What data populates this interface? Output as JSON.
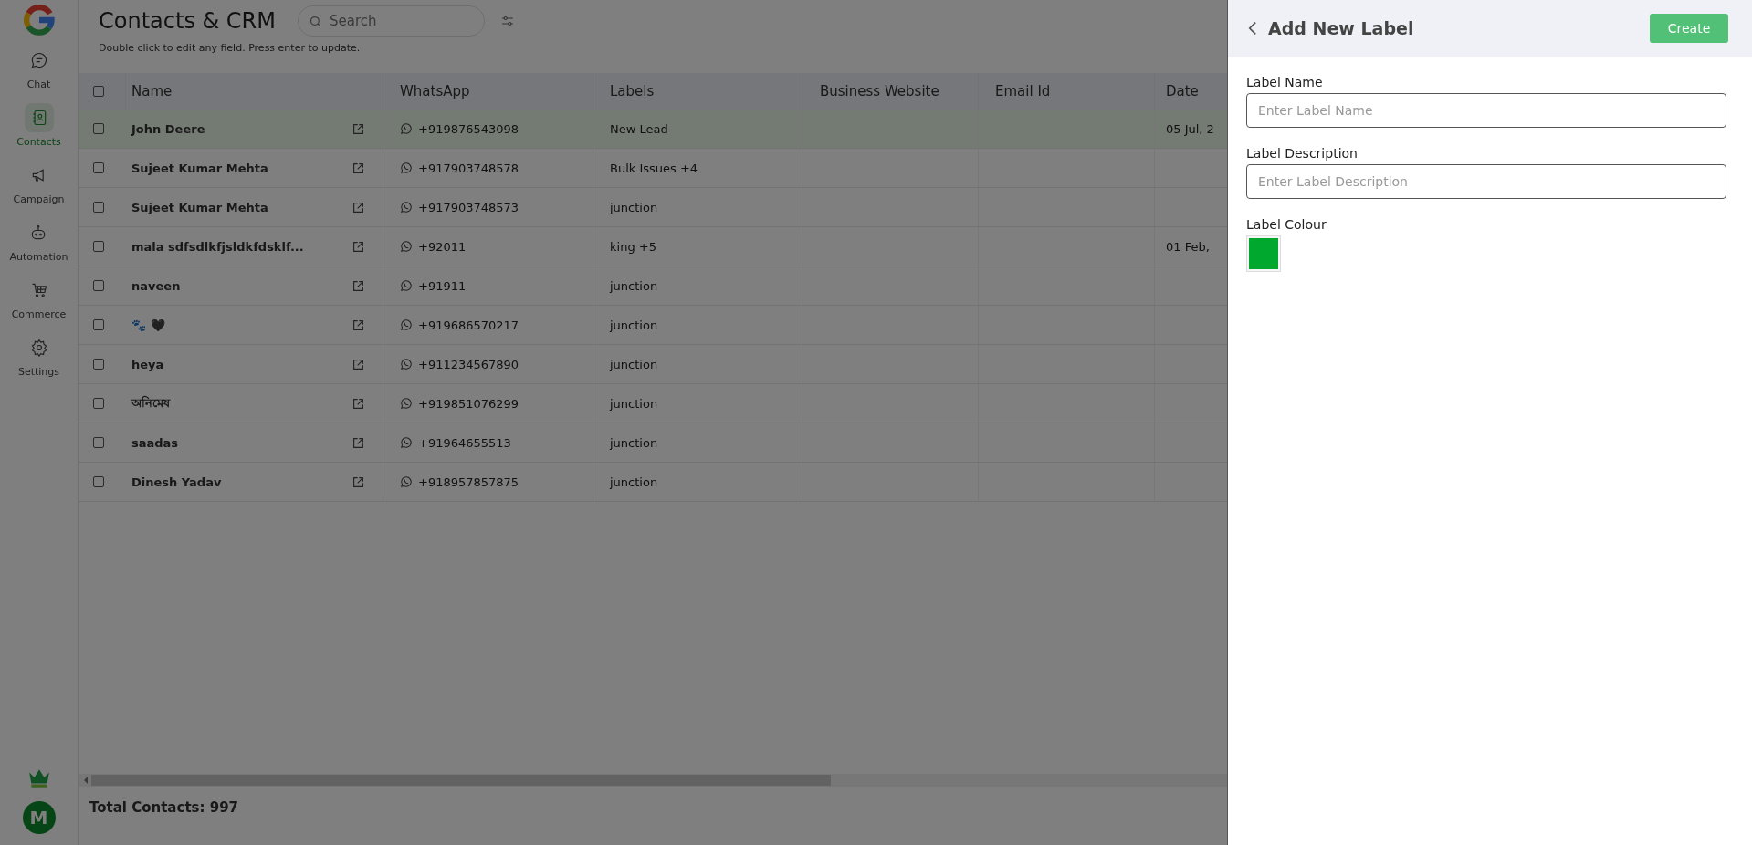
{
  "sidebar": {
    "items": [
      {
        "label": "Chat",
        "selected": false
      },
      {
        "label": "Contacts",
        "selected": true
      },
      {
        "label": "Campaign",
        "selected": false
      },
      {
        "label": "Automation",
        "selected": false
      },
      {
        "label": "Commerce",
        "selected": false
      },
      {
        "label": "Settings",
        "selected": false
      }
    ],
    "avatar": "M"
  },
  "header": {
    "title": "Contacts & CRM",
    "search": {
      "placeholder": "Search"
    },
    "hint": "Double click to edit any field. Press enter to update."
  },
  "table": {
    "all_checked": false,
    "columns": [
      "Name",
      "WhatsApp",
      "Labels",
      "Business Website",
      "Email Id",
      "Date"
    ],
    "rows": [
      {
        "name": "John Deere",
        "whatsapp": "+919876543098",
        "labels": "New Lead",
        "date": "05 Jul, 2",
        "highlighted": true,
        "checked": false
      },
      {
        "name": "Sujeet Kumar Mehta",
        "whatsapp": "+917903748578",
        "labels": "Bulk Issues +4",
        "highlighted": false,
        "checked": false
      },
      {
        "name": "Sujeet Kumar Mehta",
        "whatsapp": "+917903748573",
        "labels": "junction",
        "highlighted": false,
        "checked": false
      },
      {
        "name": "mala sdfsdlkfjsldkfdsklf...",
        "whatsapp": "+92011",
        "labels": "king +5",
        "date": "01 Feb,",
        "highlighted": false,
        "checked": false
      },
      {
        "name": "naveen",
        "whatsapp": "+91911",
        "labels": "junction",
        "highlighted": false,
        "checked": false
      },
      {
        "name": "🐾 🖤",
        "whatsapp": "+919686570217",
        "labels": "junction",
        "highlighted": false,
        "checked": false
      },
      {
        "name": "heya",
        "whatsapp": "+911234567890",
        "labels": "junction",
        "highlighted": false,
        "checked": false
      },
      {
        "name": "অনিমেষ",
        "whatsapp": "+919851076299",
        "labels": "junction",
        "highlighted": false,
        "checked": false
      },
      {
        "name": "saadas",
        "whatsapp": "+91964655513",
        "labels": "junction",
        "highlighted": false,
        "checked": false
      },
      {
        "name": "Dinesh Yadav",
        "whatsapp": "+918957857875",
        "labels": "junction",
        "highlighted": false,
        "checked": false
      }
    ]
  },
  "footer": {
    "total": "Total Contacts: 997"
  },
  "panel": {
    "title": "Add New Label",
    "create_button": "Create",
    "fields": [
      {
        "label": "Label Name",
        "placeholder": "Enter Label Name"
      },
      {
        "label": "Label Description",
        "placeholder": "Enter Label Description"
      }
    ],
    "colour_label": "Label Colour"
  }
}
